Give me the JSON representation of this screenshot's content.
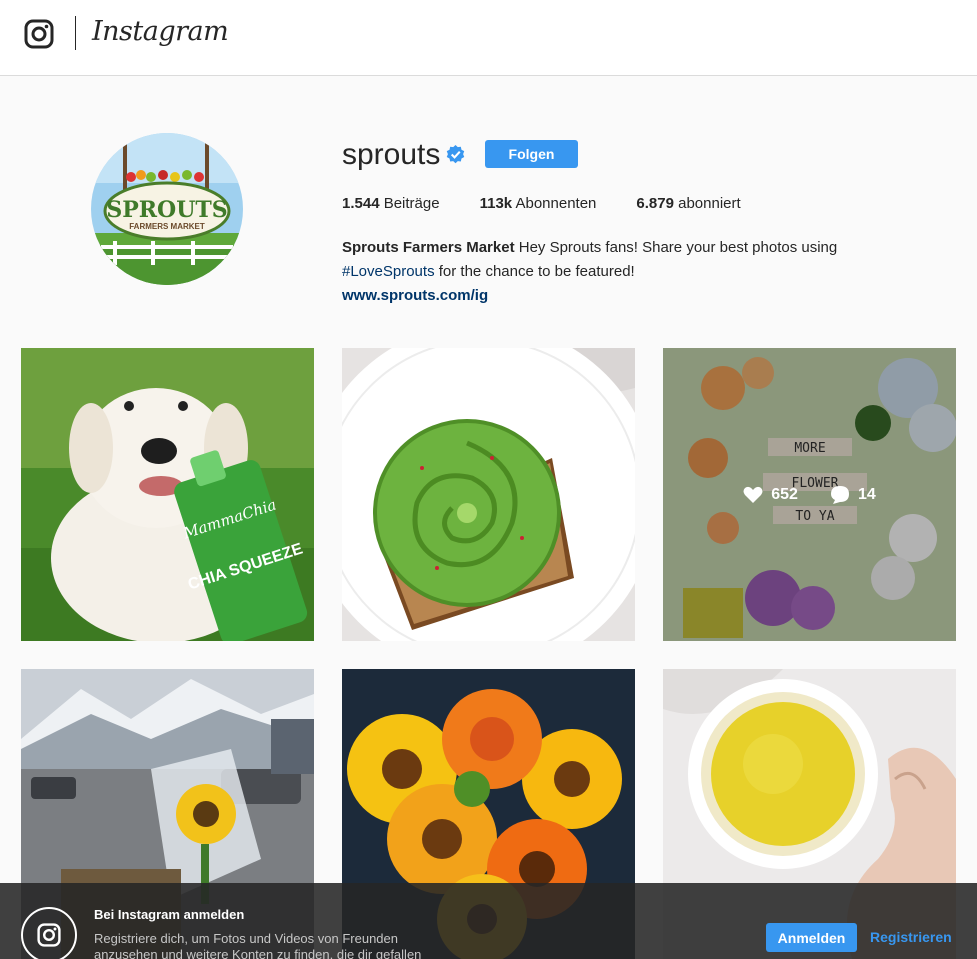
{
  "header": {
    "wordmark": "Instagram"
  },
  "profile": {
    "username": "sprouts",
    "follow_label": "Folgen",
    "stats": [
      {
        "value": "1.544",
        "label": " Beiträge"
      },
      {
        "value": "113k",
        "label": " Abonnenten"
      },
      {
        "value": "6.879",
        "label": " abonniert"
      }
    ],
    "bio": {
      "name": "Sprouts Farmers Market",
      "text_part1": " Hey Sprouts fans! Share your best photos using ",
      "hashtag": "#LoveSprouts",
      "text_part2": " for the chance to be featured!",
      "link": "www.sprouts.com/ig"
    },
    "avatar_logo_main": "SPROUTS",
    "avatar_logo_sub": "FARMERS MARKET"
  },
  "posts": [
    {
      "subject": "puppy with chia squeeze pouch",
      "pouch_text": "CHIA SQUEEZE"
    },
    {
      "subject": "avocado rose toast"
    },
    {
      "subject": "more flower to ya tiles",
      "tiles": [
        "MORE",
        "FLOWER",
        "TO YA"
      ],
      "likes": "652",
      "comments": "14",
      "hovered": true
    },
    {
      "subject": "sunflower bouquet in parking lot"
    },
    {
      "subject": "orange sunflower bouquet"
    },
    {
      "subject": "golden milk latte cup"
    }
  ],
  "login_bar": {
    "title": "Bei Instagram anmelden",
    "text": "Registriere dich, um Fotos und Videos von Freunden anzusehen und weitere Konten zu finden, die dir gefallen",
    "login_label": "Anmelden",
    "register_label": "Registrieren"
  },
  "colors": {
    "accent": "#3897f0",
    "link": "#003569",
    "text": "#262626",
    "background": "#fafafa"
  }
}
